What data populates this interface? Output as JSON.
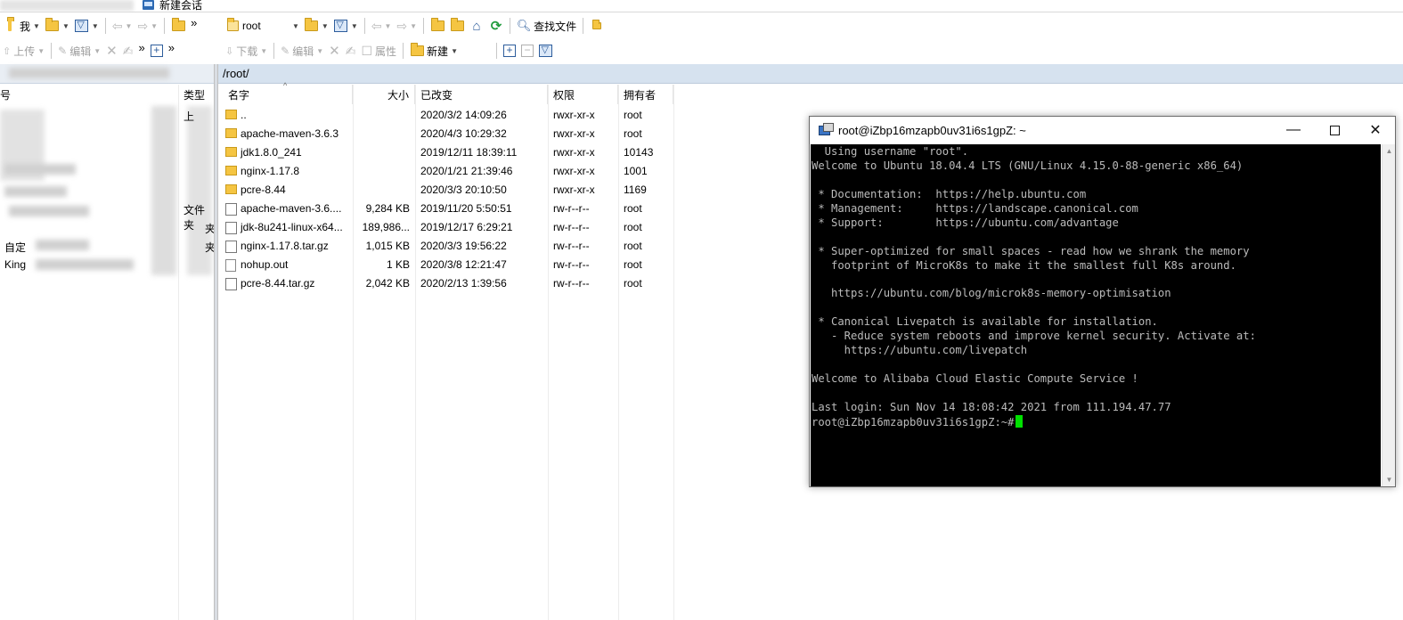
{
  "tabs": {
    "new_session": "新建会话"
  },
  "left_toolbar1": {
    "drive_label": "我"
  },
  "left_toolbar2": {
    "upload": "上传",
    "edit": "编辑"
  },
  "left_columns": {
    "name": "号",
    "type": "类型"
  },
  "left_rows": [
    {
      "name": "",
      "type": "上"
    },
    {
      "name": "",
      "type": ""
    },
    {
      "name": "",
      "type": ""
    },
    {
      "name": "",
      "type": ""
    },
    {
      "name": "",
      "type": ""
    },
    {
      "name": "",
      "type": "文件夹"
    },
    {
      "name": "",
      "type": "夹"
    },
    {
      "name": "自定",
      "type": "夹"
    },
    {
      "name": "King",
      "type": ""
    }
  ],
  "right_toolbar1": {
    "path_value": "root",
    "find_files": "查找文件"
  },
  "right_toolbar2": {
    "download": "下载",
    "edit": "编辑",
    "properties": "属性",
    "new": "新建"
  },
  "current_path": "/root/",
  "right_columns": {
    "name": "名字",
    "size": "大小",
    "modified": "已改变",
    "permissions": "权限",
    "owner": "拥有者"
  },
  "files": [
    {
      "icon": "parent-folder",
      "name": "..",
      "size": "",
      "modified": "2020/3/2 14:09:26",
      "permissions": "rwxr-xr-x",
      "owner": "root"
    },
    {
      "icon": "folder",
      "name": "apache-maven-3.6.3",
      "size": "",
      "modified": "2020/4/3 10:29:32",
      "permissions": "rwxr-xr-x",
      "owner": "root"
    },
    {
      "icon": "folder",
      "name": "jdk1.8.0_241",
      "size": "",
      "modified": "2019/12/11 18:39:11",
      "permissions": "rwxr-xr-x",
      "owner": "10143"
    },
    {
      "icon": "folder",
      "name": "nginx-1.17.8",
      "size": "",
      "modified": "2020/1/21 21:39:46",
      "permissions": "rwxr-xr-x",
      "owner": "1001"
    },
    {
      "icon": "folder",
      "name": "pcre-8.44",
      "size": "",
      "modified": "2020/3/3 20:10:50",
      "permissions": "rwxr-xr-x",
      "owner": "1169"
    },
    {
      "icon": "archive",
      "name": "apache-maven-3.6....",
      "size": "9,284 KB",
      "modified": "2019/11/20 5:50:51",
      "permissions": "rw-r--r--",
      "owner": "root"
    },
    {
      "icon": "archive",
      "name": "jdk-8u241-linux-x64...",
      "size": "189,986...",
      "modified": "2019/12/17 6:29:21",
      "permissions": "rw-r--r--",
      "owner": "root"
    },
    {
      "icon": "archive",
      "name": "nginx-1.17.8.tar.gz",
      "size": "1,015 KB",
      "modified": "2020/3/3 19:56:22",
      "permissions": "rw-r--r--",
      "owner": "root"
    },
    {
      "icon": "file",
      "name": "nohup.out",
      "size": "1 KB",
      "modified": "2020/3/8 12:21:47",
      "permissions": "rw-r--r--",
      "owner": "root"
    },
    {
      "icon": "archive",
      "name": "pcre-8.44.tar.gz",
      "size": "2,042 KB",
      "modified": "2020/2/13 1:39:56",
      "permissions": "rw-r--r--",
      "owner": "root"
    }
  ],
  "terminal": {
    "title": "root@iZbp16mzapb0uv31i6s1gpZ: ~",
    "lines": [
      "  Using username \"root\".",
      "Welcome to Ubuntu 18.04.4 LTS (GNU/Linux 4.15.0-88-generic x86_64)",
      "",
      " * Documentation:  https://help.ubuntu.com",
      " * Management:     https://landscape.canonical.com",
      " * Support:        https://ubuntu.com/advantage",
      "",
      " * Super-optimized for small spaces - read how we shrank the memory",
      "   footprint of MicroK8s to make it the smallest full K8s around.",
      "",
      "   https://ubuntu.com/blog/microk8s-memory-optimisation",
      "",
      " * Canonical Livepatch is available for installation.",
      "   - Reduce system reboots and improve kernel security. Activate at:",
      "     https://ubuntu.com/livepatch",
      "",
      "Welcome to Alibaba Cloud Elastic Compute Service !",
      "",
      "Last login: Sun Nov 14 18:08:42 2021 from 111.194.47.77"
    ],
    "prompt": "root@iZbp16mzapb0uv31i6s1gpZ:~#",
    "cursor_color": "#00e000",
    "bg_color": "#000000",
    "fg_color": "#bbbbbb"
  },
  "colors": {
    "path_bar": "#d6e2ef",
    "folder": "#f5c542",
    "accent_blue": "#2d5d9c"
  }
}
